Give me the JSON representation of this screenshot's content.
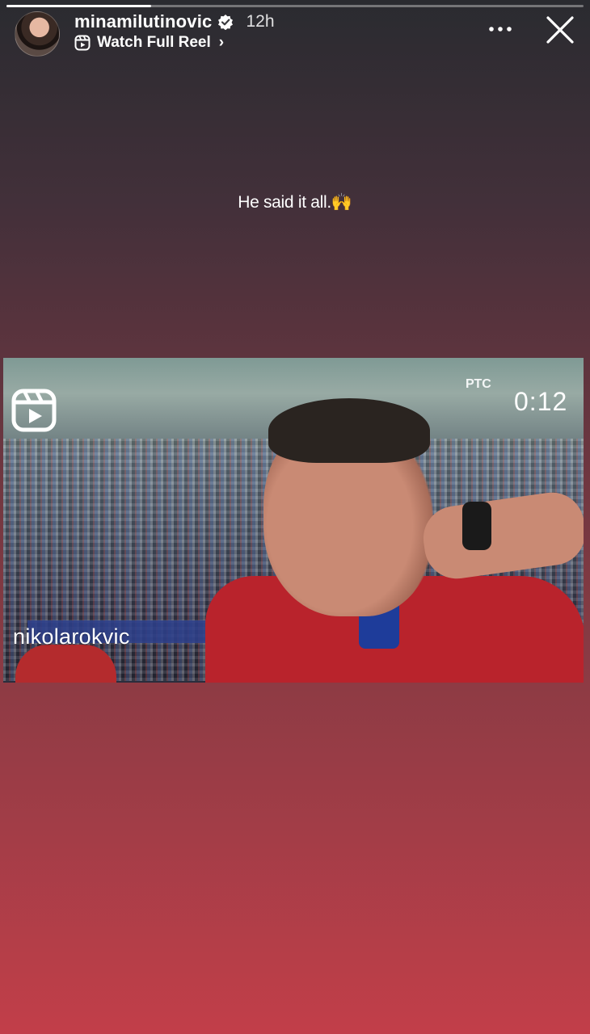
{
  "story": {
    "progress": 0.25
  },
  "header": {
    "username": "minamilutinovic",
    "time": "12h",
    "reel_label": "Watch Full Reel",
    "chevron": "›",
    "icons": {
      "verified": "verified-badge-icon",
      "reel": "reel-icon",
      "more": "more-horizontal-icon",
      "close": "close-icon"
    }
  },
  "caption": {
    "text": "He said it all.",
    "emoji": "🙌"
  },
  "video": {
    "timer": "0:12",
    "broadcaster_logo": "РТС",
    "watermark": "nikolarokvic",
    "reel_icon": "reel-icon"
  },
  "colors": {
    "background_top": "#2a2b30",
    "background_bottom": "#c23e49",
    "text": "#ffffff"
  }
}
